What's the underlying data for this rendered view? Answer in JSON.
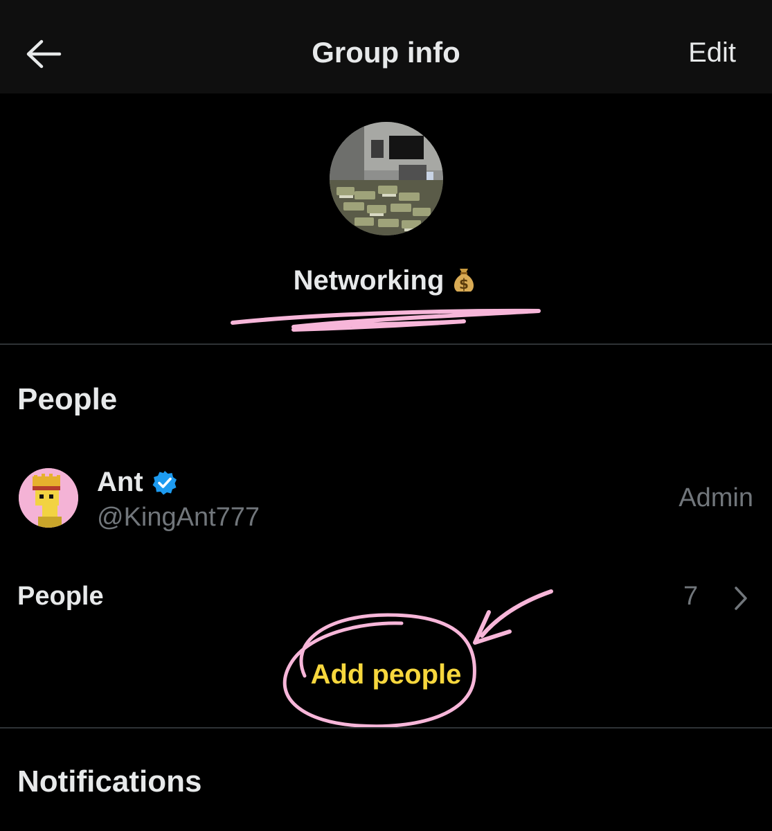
{
  "header": {
    "title": "Group info",
    "edit_label": "Edit",
    "back_icon": "arrow-left-icon"
  },
  "group": {
    "name": "Networking",
    "emoji": "money-bag-icon",
    "avatar": "group-photo"
  },
  "people_section": {
    "title": "People",
    "members": [
      {
        "name": "Ant",
        "handle": "@KingAnt777",
        "role": "Admin",
        "verified": true
      }
    ],
    "people_row_label": "People",
    "people_count": "7",
    "add_people_label": "Add people"
  },
  "notifications_section": {
    "title": "Notifications"
  },
  "colors": {
    "background": "#000000",
    "header_bg": "#0f0f0f",
    "text_primary": "#e7e9ea",
    "text_secondary": "#71767b",
    "verified_blue": "#1d9bf0",
    "add_people_yellow": "#f7d73d",
    "annotation_pink": "#f7b6d9"
  }
}
